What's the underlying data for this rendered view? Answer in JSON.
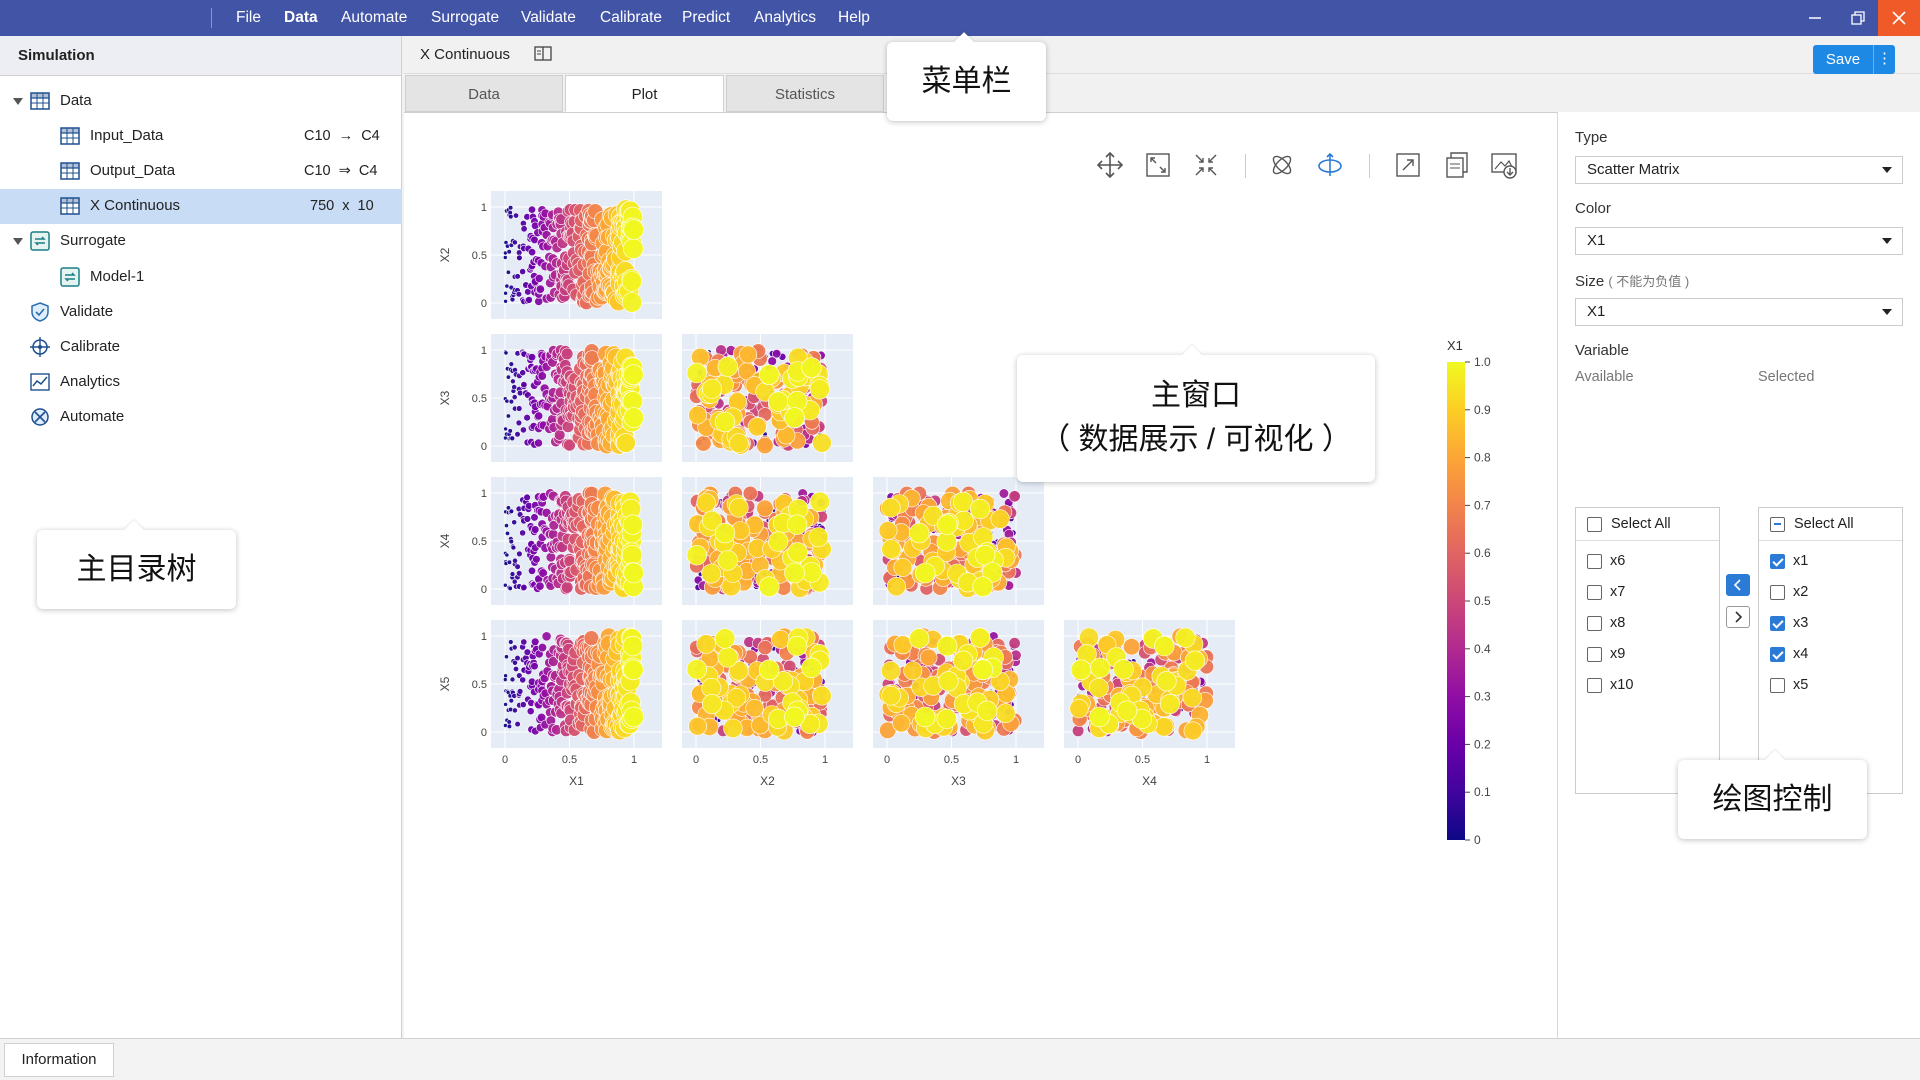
{
  "menubar": {
    "items": [
      "File",
      "Data",
      "Automate",
      "Surrogate",
      "Validate",
      "Calibrate",
      "Predict",
      "Analytics",
      "Help"
    ],
    "active": "Data",
    "color": "#4254a6"
  },
  "left_panel": {
    "title": "Simulation",
    "tree": [
      {
        "label": "Data",
        "icon": "table-icon",
        "meta": ""
      },
      {
        "label": "Input_Data",
        "icon": "table-icon",
        "meta": "C10  →  C4"
      },
      {
        "label": "Output_Data",
        "icon": "table-icon",
        "meta": "C10  ⇒  C4"
      },
      {
        "label": "X Continuous",
        "icon": "table-icon",
        "meta": "750  x  10"
      },
      {
        "label": "Surrogate",
        "icon": "surrogate-icon",
        "meta": ""
      },
      {
        "label": "Model-1",
        "icon": "surrogate-icon",
        "meta": ""
      },
      {
        "label": "Validate",
        "icon": "shield-check-icon",
        "meta": ""
      },
      {
        "label": "Calibrate",
        "icon": "crosshair-icon",
        "meta": ""
      },
      {
        "label": "Analytics",
        "icon": "chart-icon",
        "meta": ""
      },
      {
        "label": "Automate",
        "icon": "automate-icon",
        "meta": ""
      }
    ],
    "selected": "X Continuous"
  },
  "info_bar": {
    "tab": "Information"
  },
  "doc": {
    "title": "X Continuous",
    "save": "Save",
    "more": "⋮"
  },
  "tabs": [
    "Data",
    "Plot",
    "Statistics"
  ],
  "active_tab": "Plot",
  "toolbar_icons": [
    "pan-icon",
    "zoom-in-icon",
    "zoom-out-icon",
    "autoscale-icon",
    "rotate-icon",
    "expand-icon",
    "copy-icon",
    "save-image-icon"
  ],
  "right_panel": {
    "type_label": "Type",
    "type_value": "Scatter Matrix",
    "color_label": "Color",
    "color_value": "X1",
    "size_label": "Size",
    "size_note": "( 不能为负值 )",
    "size_value": "X1",
    "variable_label": "Variable",
    "available_label": "Available",
    "selected_label": "Selected",
    "select_all": "Select All",
    "available": [
      {
        "name": "x6",
        "checked": false
      },
      {
        "name": "x7",
        "checked": false
      },
      {
        "name": "x8",
        "checked": false
      },
      {
        "name": "x9",
        "checked": false
      },
      {
        "name": "x10",
        "checked": false
      }
    ],
    "selected": [
      {
        "name": "x1",
        "checked": true
      },
      {
        "name": "x2",
        "checked": false
      },
      {
        "name": "x3",
        "checked": true
      },
      {
        "name": "x4",
        "checked": true
      },
      {
        "name": "x5",
        "checked": false
      }
    ]
  },
  "callouts": {
    "menu": "菜单栏",
    "tree": "主目录树",
    "main_line1": "主窗口",
    "main_line2": "（ 数据展示 / 可视化 ）",
    "plot_control": "绘图控制"
  },
  "chart_data": {
    "type": "scatter",
    "kind": "scatter_matrix",
    "variables": [
      "X1",
      "X2",
      "X3",
      "X4",
      "X5"
    ],
    "x_variables": [
      "X1",
      "X2",
      "X3",
      "X4"
    ],
    "y_variables": [
      "X2",
      "X3",
      "X4",
      "X5"
    ],
    "n_points": 750,
    "color_by": "X1",
    "size_by": "X1",
    "colorscale": "plasma",
    "colorbar_title": "X1",
    "colorbar_ticks": [
      "0",
      "0.1",
      "0.2",
      "0.3",
      "0.4",
      "0.5",
      "0.6",
      "0.7",
      "0.8",
      "0.9",
      "1.0"
    ],
    "axis_ticks": [
      "0",
      "0.5",
      "1"
    ],
    "xlim": [
      0,
      1
    ],
    "ylim": [
      0,
      1
    ],
    "plot_background": "#e5ecf6",
    "note": "points uniformly distributed over [0,1] in every pair; color and marker size increase with X1"
  }
}
